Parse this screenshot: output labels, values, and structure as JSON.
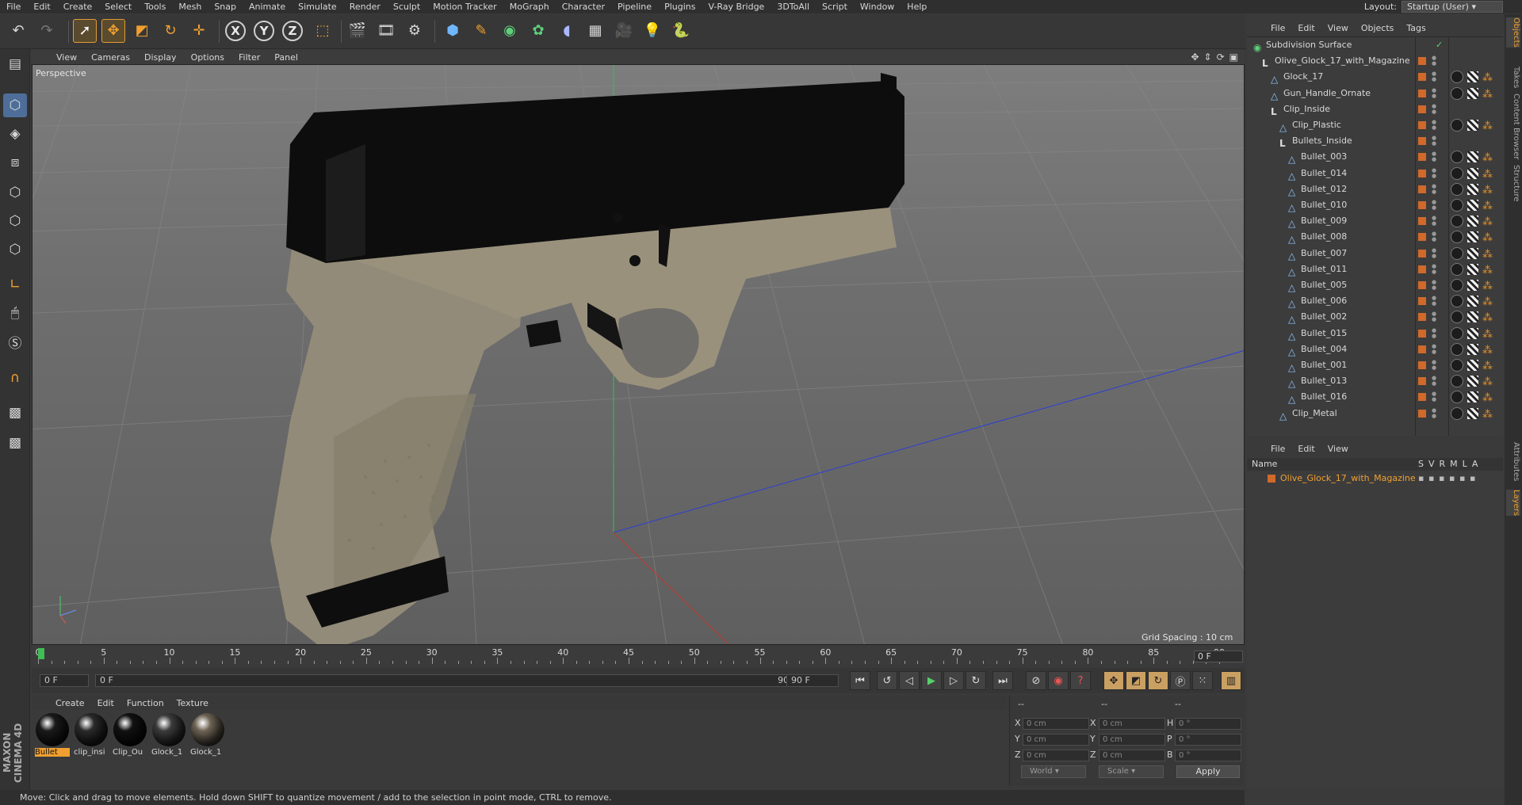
{
  "menubar": [
    "File",
    "Edit",
    "Create",
    "Select",
    "Tools",
    "Mesh",
    "Snap",
    "Animate",
    "Simulate",
    "Render",
    "Sculpt",
    "Motion Tracker",
    "MoGraph",
    "Character",
    "Pipeline",
    "Plugins",
    "V-Ray Bridge",
    "3DToAll",
    "Script",
    "Window",
    "Help"
  ],
  "layout": {
    "label": "Layout:",
    "value": "Startup (User)"
  },
  "toolbar": {
    "x_label": "X",
    "y_label": "Y",
    "z_label": "Z"
  },
  "viewport": {
    "menu": [
      "View",
      "Cameras",
      "Display",
      "Options",
      "Filter",
      "Panel"
    ],
    "label": "Perspective",
    "grid_spacing": "Grid Spacing : 10 cm"
  },
  "timeline": {
    "ticks": [
      "0",
      "5",
      "10",
      "15",
      "20",
      "25",
      "30",
      "35",
      "40",
      "45",
      "50",
      "55",
      "60",
      "65",
      "70",
      "75",
      "80",
      "85",
      "90"
    ],
    "current_frame": "0 F",
    "start_field": "0 F",
    "range_start": "0 F",
    "range_end": "90 F",
    "end_field": "90 F"
  },
  "materials": {
    "menu": [
      "Create",
      "Edit",
      "Function",
      "Texture"
    ],
    "items": [
      {
        "label": "Bullet",
        "color": "#1b1b1b",
        "selected": true
      },
      {
        "label": "clip_insi",
        "color": "#2b2b2b",
        "selected": false
      },
      {
        "label": "Clip_Ou",
        "color": "#121212",
        "selected": false
      },
      {
        "label": "Glock_1",
        "color": "#3c3c3c",
        "selected": false
      },
      {
        "label": "Glock_1",
        "color": "#6f6556",
        "selected": false
      }
    ]
  },
  "coords": {
    "col_headers": [
      "--",
      "--",
      "--"
    ],
    "rows": [
      {
        "a": "X",
        "av": "0 cm",
        "b": "X",
        "bv": "0 cm",
        "c": "H",
        "cv": "0 °"
      },
      {
        "a": "Y",
        "av": "0 cm",
        "b": "Y",
        "bv": "0 cm",
        "c": "P",
        "cv": "0 °"
      },
      {
        "a": "Z",
        "av": "0 cm",
        "b": "Z",
        "bv": "0 cm",
        "c": "B",
        "cv": "0 °"
      }
    ],
    "world": "World",
    "scale": "Scale",
    "apply": "Apply"
  },
  "status": "Move: Click and drag to move elements. Hold down SHIFT to quantize movement / add to the selection in point mode, CTRL to remove.",
  "objects": {
    "menu": [
      "File",
      "Edit",
      "View",
      "Objects",
      "Tags"
    ],
    "rows": [
      {
        "name": "Subdivision Surface",
        "indent": 0,
        "icon": "subdivision"
      },
      {
        "name": "Olive_Glock_17_with_Magazine",
        "indent": 1,
        "icon": "null"
      },
      {
        "name": "Glock_17",
        "indent": 2,
        "icon": "poly"
      },
      {
        "name": "Gun_Handle_Ornate",
        "indent": 2,
        "icon": "poly"
      },
      {
        "name": "Clip_Inside",
        "indent": 2,
        "icon": "null"
      },
      {
        "name": "Clip_Plastic",
        "indent": 3,
        "icon": "poly"
      },
      {
        "name": "Bullets_Inside",
        "indent": 3,
        "icon": "null"
      },
      {
        "name": "Bullet_003",
        "indent": 4,
        "icon": "poly"
      },
      {
        "name": "Bullet_014",
        "indent": 4,
        "icon": "poly"
      },
      {
        "name": "Bullet_012",
        "indent": 4,
        "icon": "poly"
      },
      {
        "name": "Bullet_010",
        "indent": 4,
        "icon": "poly"
      },
      {
        "name": "Bullet_009",
        "indent": 4,
        "icon": "poly"
      },
      {
        "name": "Bullet_008",
        "indent": 4,
        "icon": "poly"
      },
      {
        "name": "Bullet_007",
        "indent": 4,
        "icon": "poly"
      },
      {
        "name": "Bullet_011",
        "indent": 4,
        "icon": "poly"
      },
      {
        "name": "Bullet_005",
        "indent": 4,
        "icon": "poly"
      },
      {
        "name": "Bullet_006",
        "indent": 4,
        "icon": "poly"
      },
      {
        "name": "Bullet_002",
        "indent": 4,
        "icon": "poly"
      },
      {
        "name": "Bullet_015",
        "indent": 4,
        "icon": "poly"
      },
      {
        "name": "Bullet_004",
        "indent": 4,
        "icon": "poly"
      },
      {
        "name": "Bullet_001",
        "indent": 4,
        "icon": "poly"
      },
      {
        "name": "Bullet_013",
        "indent": 4,
        "icon": "poly"
      },
      {
        "name": "Bullet_016",
        "indent": 4,
        "icon": "poly"
      },
      {
        "name": "Clip_Metal",
        "indent": 3,
        "icon": "poly"
      }
    ]
  },
  "layers": {
    "menu": [
      "File",
      "Edit",
      "View"
    ],
    "header": {
      "name": "Name",
      "cols": [
        "S",
        "V",
        "R",
        "M",
        "L",
        "A"
      ]
    },
    "rows": [
      {
        "name": "Olive_Glock_17_with_Magazine",
        "color": "#d1692a"
      }
    ]
  },
  "right_tabs": [
    "Objects",
    "Takes",
    "Content Browser",
    "Structure",
    "Attributes",
    "Layers"
  ],
  "brand": "MAXON CINEMA 4D"
}
